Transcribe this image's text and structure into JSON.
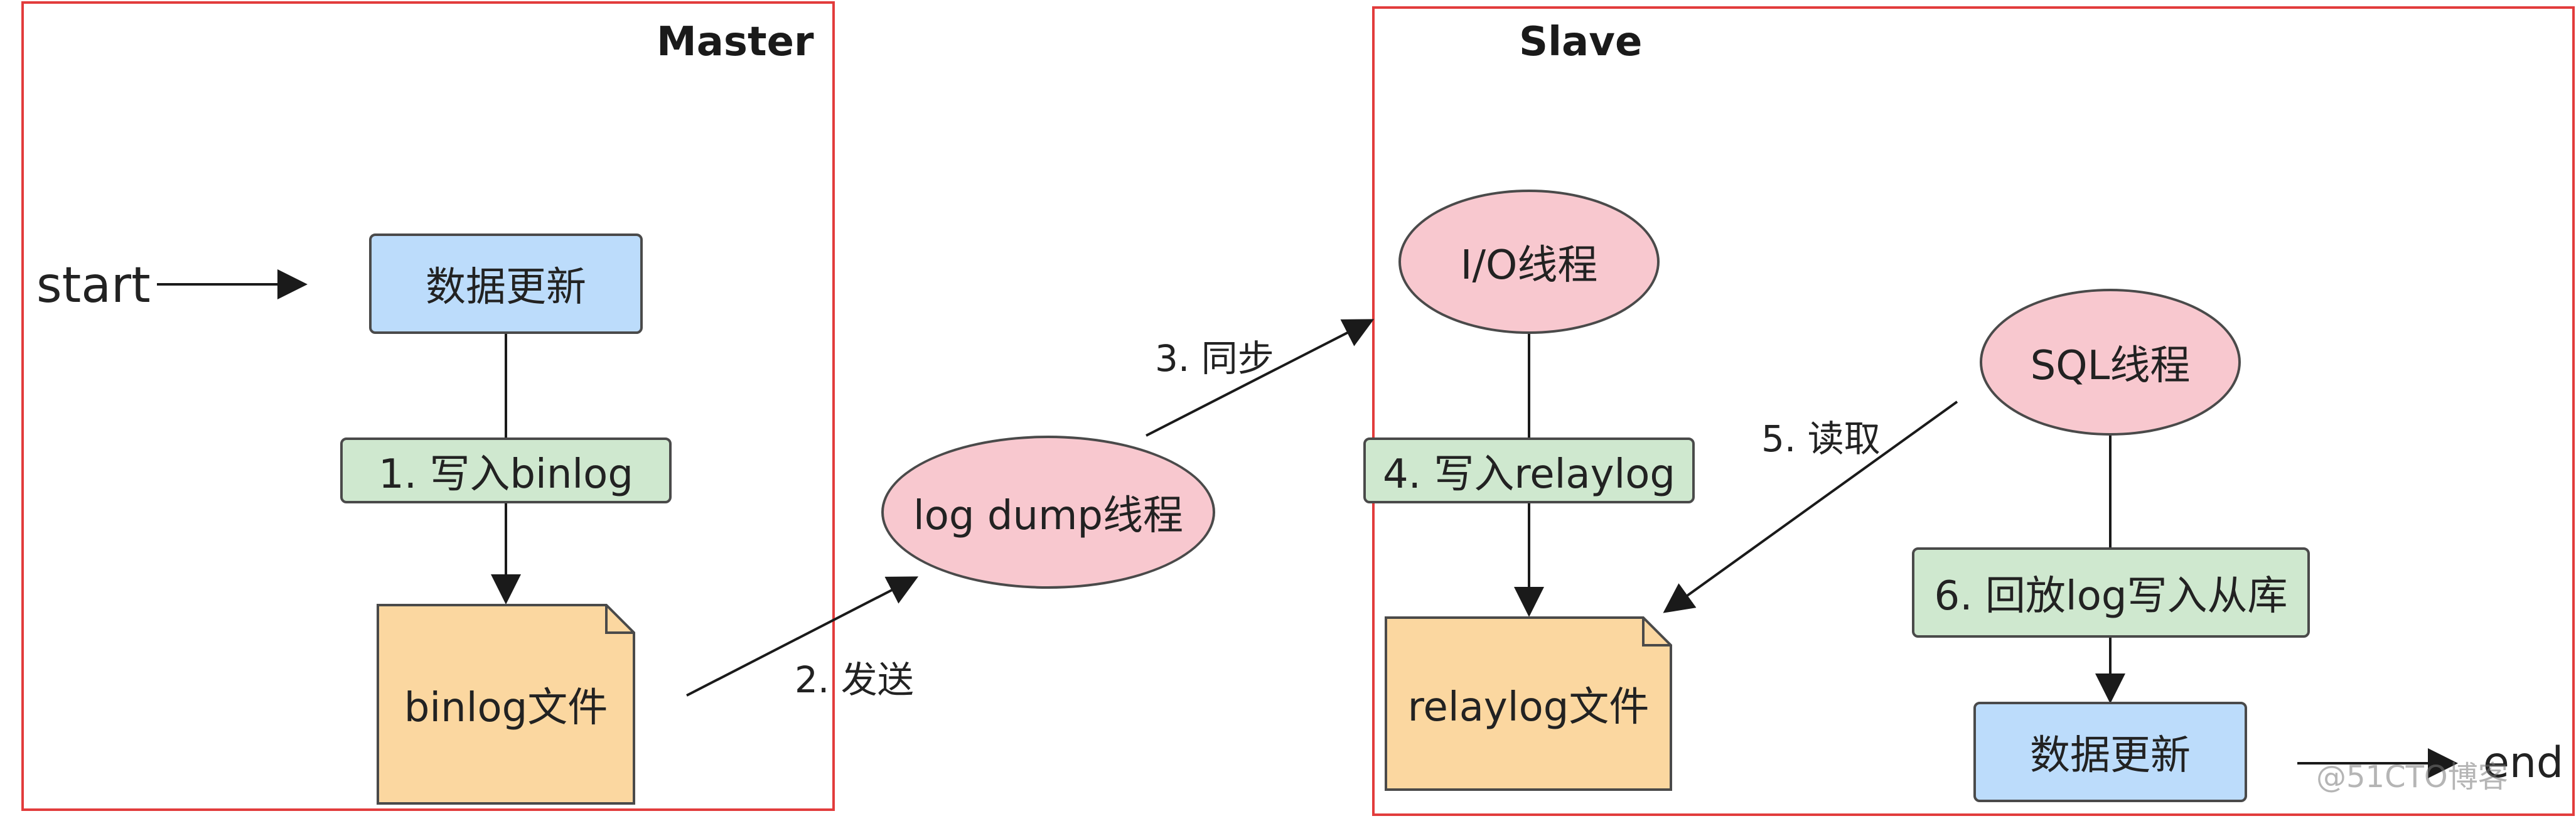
{
  "master": {
    "title": "Master"
  },
  "slave": {
    "title": "Slave"
  },
  "start_label": "start",
  "end_label": "end",
  "master_nodes": {
    "data_update": "数据更新",
    "write_binlog": "1. 写入binlog",
    "binlog_file": "binlog文件"
  },
  "log_dump": "log dump线程",
  "edges": {
    "send": "2. 发送",
    "sync": "3. 同步",
    "read": "5. 读取"
  },
  "slave_nodes": {
    "io_thread": "I/O线程",
    "write_relaylog": "4. 写入relaylog",
    "relaylog_file": "relaylog文件",
    "sql_thread": "SQL线程",
    "replay": "6. 回放log写入从库",
    "data_update": "数据更新"
  },
  "watermark": "@51CTO博客",
  "colors": {
    "frame": "#e23c3c",
    "blue_box": "#bcdcfb",
    "green_box": "#cfe8cf",
    "orange_doc": "#fbd7a0",
    "pink_ellipse": "#f8c8cf"
  }
}
